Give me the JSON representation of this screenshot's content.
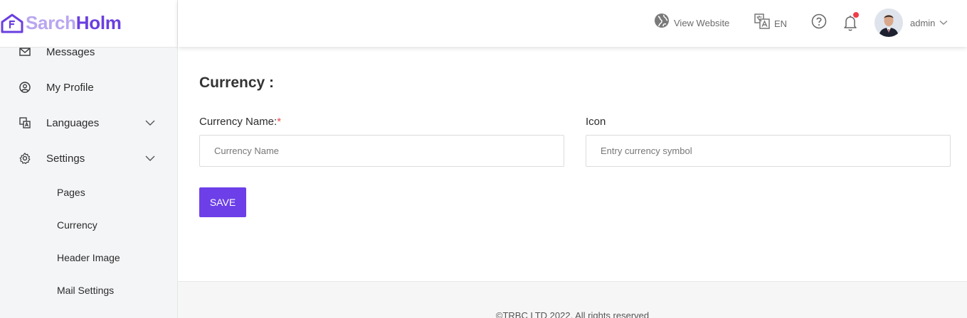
{
  "brand": {
    "name_part1": "Sarch",
    "name_part2": "Holm",
    "color_light": "#b9a6f0",
    "color_dark": "#6a3fe0"
  },
  "sidebar": {
    "items": [
      {
        "label": "Messages",
        "icon": "mail-icon"
      },
      {
        "label": "My Profile",
        "icon": "user-circle-icon"
      },
      {
        "label": "Languages",
        "icon": "translate-icon",
        "expandable": true
      },
      {
        "label": "Settings",
        "icon": "gear-icon",
        "expandable": true
      }
    ],
    "settings_subitems": [
      {
        "label": "Pages"
      },
      {
        "label": "Currency"
      },
      {
        "label": "Header Image"
      },
      {
        "label": "Mail Settings"
      }
    ]
  },
  "topbar": {
    "view_website": "View Website",
    "language": "EN",
    "user": "admin"
  },
  "main": {
    "title": "Currency :",
    "currency_name": {
      "label": "Currency Name:",
      "required_mark": "*",
      "placeholder": "Currency Name",
      "value": ""
    },
    "icon_field": {
      "label": "Icon",
      "placeholder": "Entry currency symbol",
      "value": ""
    },
    "save_label": "SAVE"
  },
  "footer": {
    "text": "©TRBC LTD 2022. All rights reserved"
  },
  "colors": {
    "accent": "#6c3fe8",
    "notification": "#f03d4a",
    "required": "#e24b4b"
  }
}
